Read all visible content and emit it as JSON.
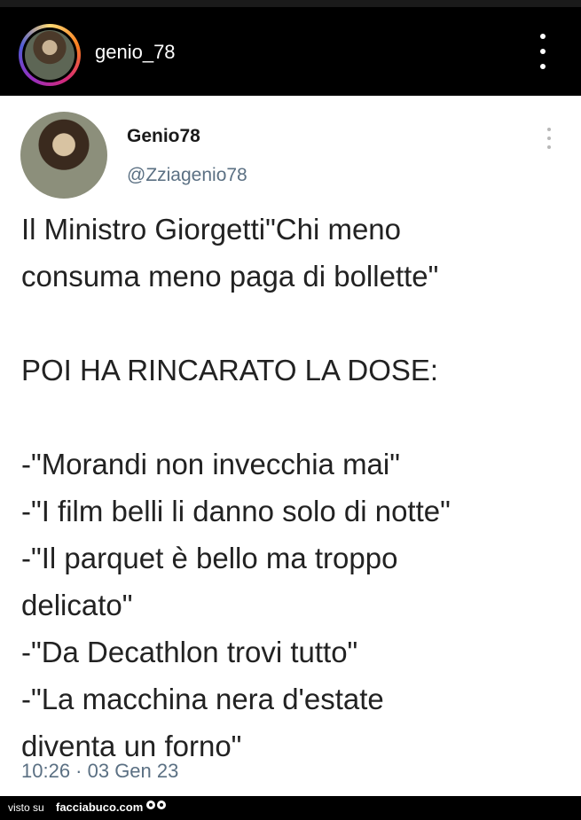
{
  "header": {
    "username": "genio_78"
  },
  "tweet": {
    "display_name": "Genio78",
    "handle": "@Zziagenio78",
    "text": "Il Ministro Giorgetti\"Chi meno\nconsuma meno paga di bollette\"\n\nPOI HA RINCARATO LA DOSE:\n\n-\"Morandi non invecchia mai\"\n-\"I film belli li danno solo di notte\"\n-\"Il parquet è bello ma troppo\ndelicato\"\n-\"Da Decathlon trovi tutto\"\n-\"La macchina nera d'estate\ndiventa un forno\"",
    "timestamp": "10:26 · 03 Gen 23"
  },
  "footer": {
    "visto_su": "visto su",
    "site": "facciabuco.com"
  }
}
